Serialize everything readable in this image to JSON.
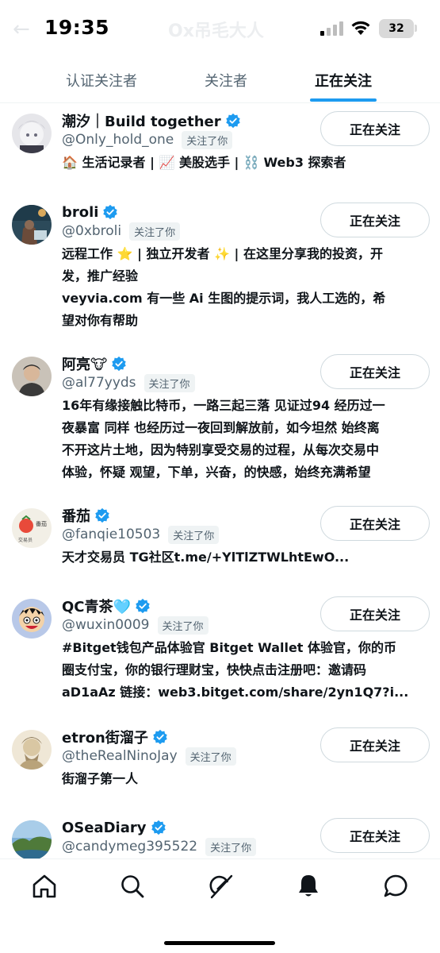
{
  "status_bar": {
    "time": "19:35",
    "faded_title": "Ox吊毛大人",
    "battery": "32"
  },
  "tabs": [
    {
      "label": "认证关注者",
      "active": false
    },
    {
      "label": "关注者",
      "active": false
    },
    {
      "label": "正在关注",
      "active": true
    }
  ],
  "users": [
    {
      "name": "潮汐｜Build together",
      "handle": "@Only_hold_one",
      "follows_you": "关注了你",
      "button": "正在关注",
      "bio": [
        "🏠 生活记录者 | 📈 美股选手 | ⛓️ Web3 探索者"
      ]
    },
    {
      "name": "broli",
      "handle": "@0xbroli",
      "follows_you": "关注了你",
      "button": "正在关注",
      "bio": [
        "远程工作 ⭐ | 独立开发者 ✨ | 在这里分享我的投资，开",
        "发，推广经验",
        "veyvia.com 有一些 Ai 生图的提示词，我人工选的，希",
        "望对你有帮助"
      ]
    },
    {
      "name": "阿亮🐮",
      "handle": "@al77yyds",
      "follows_you": "关注了你",
      "button": "正在关注",
      "bio": [
        "16年有缘接触比特币，一路三起三落 见证过94 经历过一",
        "夜暴富 同样 也经历过一夜回到解放前，如今坦然 始终离",
        "不开这片土地，因为特别享受交易的过程，从每次交易中",
        "体验，怀疑 观望，下单，兴奋，的快感，始终充满希望"
      ]
    },
    {
      "name": "番茄",
      "handle": "@fanqie10503",
      "follows_you": "关注了你",
      "button": "正在关注",
      "bio": [
        "天才交易员 TG社区t.me/+YlTlZTWLhtEwO..."
      ]
    },
    {
      "name": "QC青茶🩵",
      "handle": "@wuxin0009",
      "follows_you": "关注了你",
      "button": "正在关注",
      "bio": [
        "#Bitget钱包产品体验官 Bitget Wallet 体验官，你的币",
        "圈支付宝，你的银行理财宝，快快点击注册吧：邀请码",
        "aD1aAz 链接：web3.bitget.com/share/2yn1Q7?i..."
      ]
    },
    {
      "name": "etron街溜子",
      "handle": "@theRealNinoJay",
      "follows_you": "关注了你",
      "button": "正在关注",
      "bio": [
        "街溜子第一人"
      ]
    },
    {
      "name": "OSeaDiary",
      "handle": "@candymeg395522",
      "follows_you": "关注了你",
      "button": "正在关注",
      "bio": []
    }
  ],
  "nav": [
    "home-icon",
    "search-icon",
    "grok-icon",
    "notifications-icon",
    "messages-icon"
  ],
  "colors": {
    "accent": "#1d9bf0",
    "text": "#0f1419",
    "secondary": "#536471"
  }
}
